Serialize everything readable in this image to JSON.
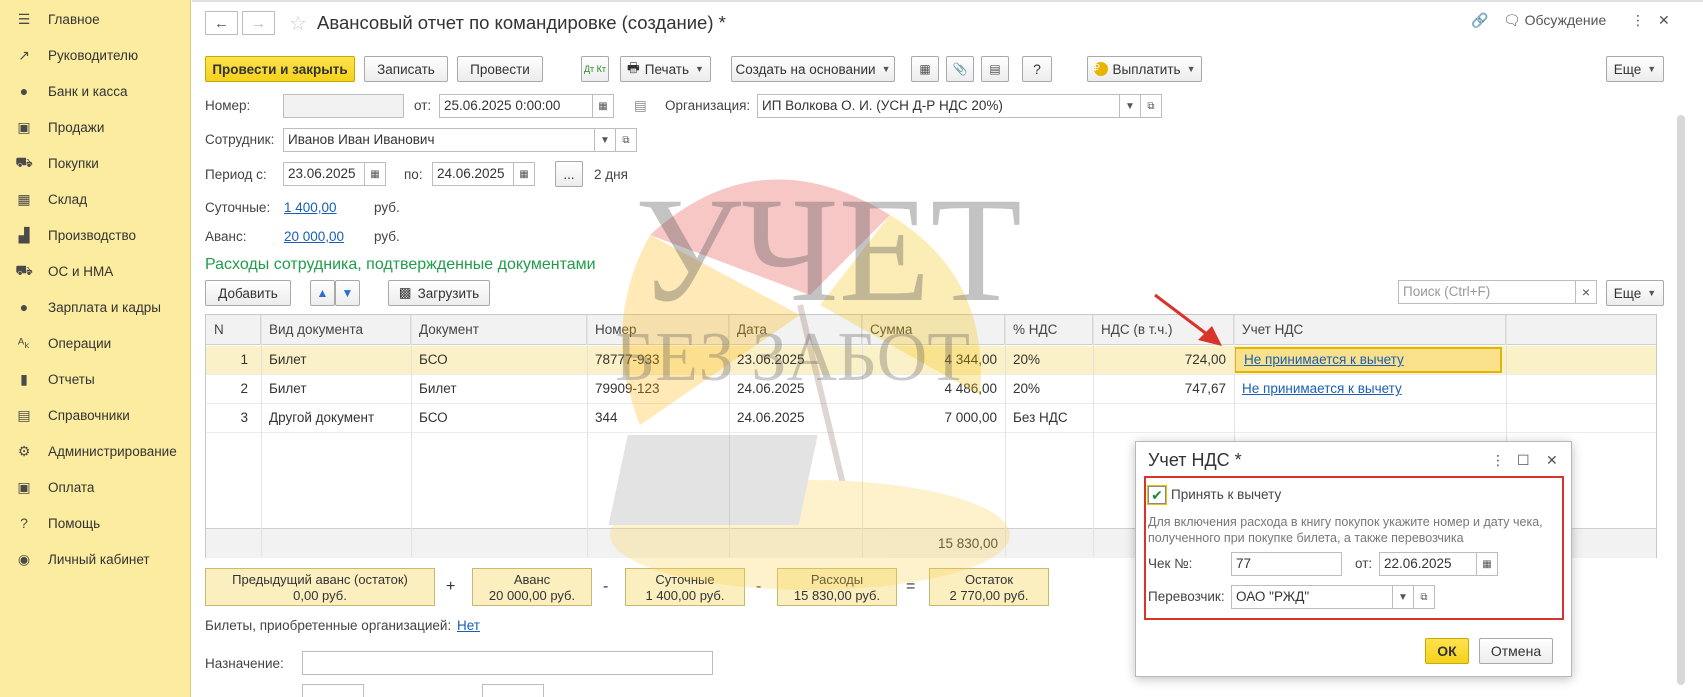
{
  "sidebar": {
    "items": [
      {
        "label": "Главное",
        "icon": "menu-icon",
        "glyph": "☰"
      },
      {
        "label": "Руководителю",
        "icon": "trend-icon",
        "glyph": "↗"
      },
      {
        "label": "Банк и касса",
        "icon": "coin-icon",
        "glyph": "●"
      },
      {
        "label": "Продажи",
        "icon": "bag-icon",
        "glyph": "▣"
      },
      {
        "label": "Покупки",
        "icon": "cart-icon",
        "glyph": "⛟"
      },
      {
        "label": "Склад",
        "icon": "warehouse-icon",
        "glyph": "▦"
      },
      {
        "label": "Производство",
        "icon": "factory-icon",
        "glyph": "▟"
      },
      {
        "label": "ОС и НМА",
        "icon": "truck-icon",
        "glyph": "⛟"
      },
      {
        "label": "Зарплата и кадры",
        "icon": "person-icon",
        "glyph": "●"
      },
      {
        "label": "Операции",
        "icon": "dt-kt-icon",
        "glyph": "ᴬₖ"
      },
      {
        "label": "Отчеты",
        "icon": "bar-chart-icon",
        "glyph": "▮"
      },
      {
        "label": "Справочники",
        "icon": "books-icon",
        "glyph": "▤"
      },
      {
        "label": "Администрирование",
        "icon": "gear-icon",
        "glyph": "⚙"
      },
      {
        "label": "Оплата",
        "icon": "payment-icon",
        "glyph": "▣"
      },
      {
        "label": "Помощь",
        "icon": "question-icon",
        "glyph": "?"
      },
      {
        "label": "Личный кабинет",
        "icon": "account-icon",
        "glyph": "◉"
      }
    ]
  },
  "header": {
    "title": "Авансовый отчет по командировке (создание) *",
    "discuss": "Обсуждение"
  },
  "toolbar": {
    "post_close": "Провести и закрыть",
    "save": "Записать",
    "post": "Провести",
    "dtkt": "Дт Кт",
    "print": "Печать",
    "create_based": "Создать на основании",
    "help": "?",
    "pay": "Выплатить",
    "more": "Еще"
  },
  "form": {
    "number_label": "Номер:",
    "number_value": "",
    "from_label": "от:",
    "date_value": "25.06.2025  0:00:00",
    "org_label": "Организация:",
    "org_value": "ИП Волкова О. И. (УСН Д-Р НДС 20%)",
    "employee_label": "Сотрудник:",
    "employee_value": "Иванов Иван Иванович",
    "period_label": "Период с:",
    "period_from": "23.06.2025",
    "period_to_label": "по:",
    "period_to": "24.06.2025",
    "period_more": "...",
    "period_days": "2 дня",
    "daily_label": "Суточные:",
    "daily_value": "1 400,00",
    "daily_unit": "руб.",
    "advance_label": "Аванс:",
    "advance_value": "20 000,00",
    "advance_unit": "руб."
  },
  "section": {
    "title": "Расходы сотрудника, подтвержденные документами",
    "add": "Добавить",
    "load": "Загрузить",
    "search_placeholder": "Поиск (Ctrl+F)",
    "search_clear": "×",
    "more": "Еще"
  },
  "table": {
    "columns": [
      "N",
      "Вид документа",
      "Документ",
      "Номер",
      "Дата",
      "Сумма",
      "% НДС",
      "НДС (в т.ч.)",
      "Учет НДС"
    ],
    "rows": [
      {
        "n": "1",
        "kind": "Билет",
        "doc": "БСО",
        "num": "78777-933",
        "date": "23.06.2025",
        "sum": "4 344,00",
        "vat": "20%",
        "vat_sum": "724,00",
        "vat_acc": "Не принимается к вычету"
      },
      {
        "n": "2",
        "kind": "Билет",
        "doc": "Билет",
        "num": "79909-123",
        "date": "24.06.2025",
        "sum": "4 486,00",
        "vat": "20%",
        "vat_sum": "747,67",
        "vat_acc": "Не принимается к вычету"
      },
      {
        "n": "3",
        "kind": "Другой документ",
        "doc": "БСО",
        "num": "344",
        "date": "24.06.2025",
        "sum": "7 000,00",
        "vat": "Без НДС",
        "vat_sum": "",
        "vat_acc": ""
      }
    ],
    "total": "15 830,00"
  },
  "summary": {
    "prev_label": "Предыдущий аванс (остаток)",
    "prev_value": "0,00 руб.",
    "advance_label": "Аванс",
    "advance_value": "20 000,00 руб.",
    "daily_label": "Суточные",
    "daily_value": "1 400,00 руб.",
    "expenses_label": "Расходы",
    "expenses_value": "15 830,00 руб.",
    "rest_label": "Остаток",
    "rest_value": "2 770,00 руб.",
    "op_plus": "+",
    "op_minus1": "-",
    "op_minus2": "-",
    "op_eq": "="
  },
  "tickets": {
    "label": "Билеты, приобретенные организацией:",
    "value": "Нет"
  },
  "purpose": {
    "label": "Назначение:",
    "value": ""
  },
  "dialog": {
    "title": "Учет НДС *",
    "accept_label": "Принять к вычету",
    "hint": "Для включения расхода в книгу покупок укажите номер и дату чека, полученного при покупке билета, а также перевозчика",
    "check_label": "Чек №:",
    "check_value": "77",
    "from_label": "от:",
    "check_date": "22.06.2025",
    "carrier_label": "Перевозчик:",
    "carrier_value": "ОАО \"РЖД\"",
    "ok": "ОК",
    "cancel": "Отмена"
  },
  "watermark": {
    "line1": "УЧЕТ",
    "line2": "БЕЗ ЗАБОТ"
  },
  "colors": {
    "sidebar_bg": "#fbec9f",
    "primary_button": "#f5d21c",
    "link": "#1a5fb4",
    "section_title": "#1f9d4a",
    "highlight_red": "#d9342b",
    "selected_row": "#fbf1c8"
  }
}
